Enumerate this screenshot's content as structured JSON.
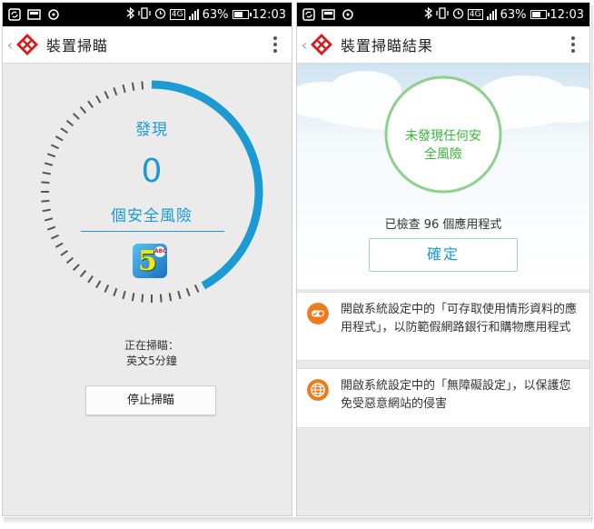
{
  "status_bar": {
    "battery": "63%",
    "time": "12:03",
    "network": "4G"
  },
  "left_screen": {
    "title": "裝置掃瞄",
    "found_label": "發現",
    "risk_count": "0",
    "risk_label": "個安全風險",
    "scan_progress": 0.42,
    "scan_status": "正在掃瞄：",
    "scan_current_app": "英文5分鐘",
    "app_icon": {
      "glyph": "5",
      "badge": "ABC"
    },
    "stop_button": "停止掃瞄"
  },
  "right_screen": {
    "title": "裝置掃瞄結果",
    "result_line1": "未發現任何安",
    "result_line2": "全風險",
    "scanned_count": "已檢查 96 個應用程式",
    "confirm_button": "確定",
    "tips": [
      {
        "icon": "toggle-icon",
        "text": "開啟系統設定中的「可存取使用情形資料的應用程式」，以防範假網路銀行和購物應用程式"
      },
      {
        "icon": "globe-icon",
        "text": "開啟系統設定中的「無障礙設定」，以保護您免受惡意網站的侵害"
      }
    ]
  },
  "colors": {
    "accent_blue": "#1b9ad3",
    "success_green": "#38b63a",
    "tip_orange": "#ef7b20",
    "logo_red": "#d71920"
  }
}
